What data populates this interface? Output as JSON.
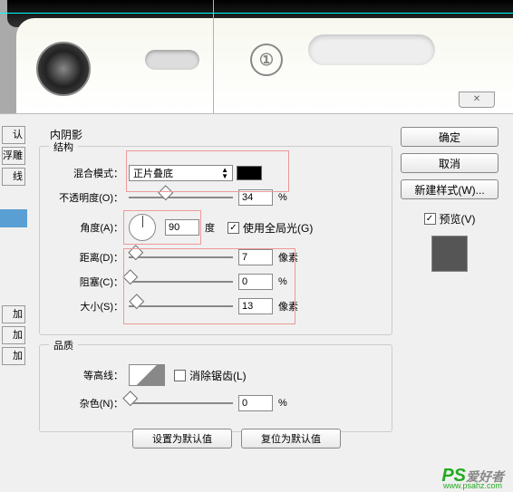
{
  "section_title": "内阴影",
  "structure": {
    "legend": "结构",
    "blend_mode": {
      "label": "混合模式：",
      "value": "正片叠底"
    },
    "opacity": {
      "label": "不透明度(O)：",
      "value": "34",
      "unit": "%"
    },
    "angle": {
      "label": "角度(A)：",
      "value": "90",
      "unit": "度",
      "global": "使用全局光(G)"
    },
    "distance": {
      "label": "距离(D)：",
      "value": "7",
      "unit": "像素"
    },
    "choke": {
      "label": "阻塞(C)：",
      "value": "0",
      "unit": "%"
    },
    "size": {
      "label": "大小(S)：",
      "value": "13",
      "unit": "像素"
    }
  },
  "quality": {
    "legend": "品质",
    "contour": {
      "label": "等高线：",
      "anti": "消除锯齿(L)"
    },
    "noise": {
      "label": "杂色(N)：",
      "value": "0",
      "unit": "%"
    }
  },
  "bottom": {
    "default": "设置为默认值",
    "reset": "复位为默认值"
  },
  "right": {
    "ok": "确定",
    "cancel": "取消",
    "newstyle": "新建样式(W)...",
    "preview": "预览(V)"
  },
  "left": {
    "b1": "认",
    "b2": "浮雕",
    "b3": "线",
    "b4": "加",
    "b5": "加",
    "b6": "加"
  },
  "close_x": "✕",
  "watermark": {
    "ps": "PS",
    "text": "爱好者",
    "url": "www.psahz.com"
  }
}
